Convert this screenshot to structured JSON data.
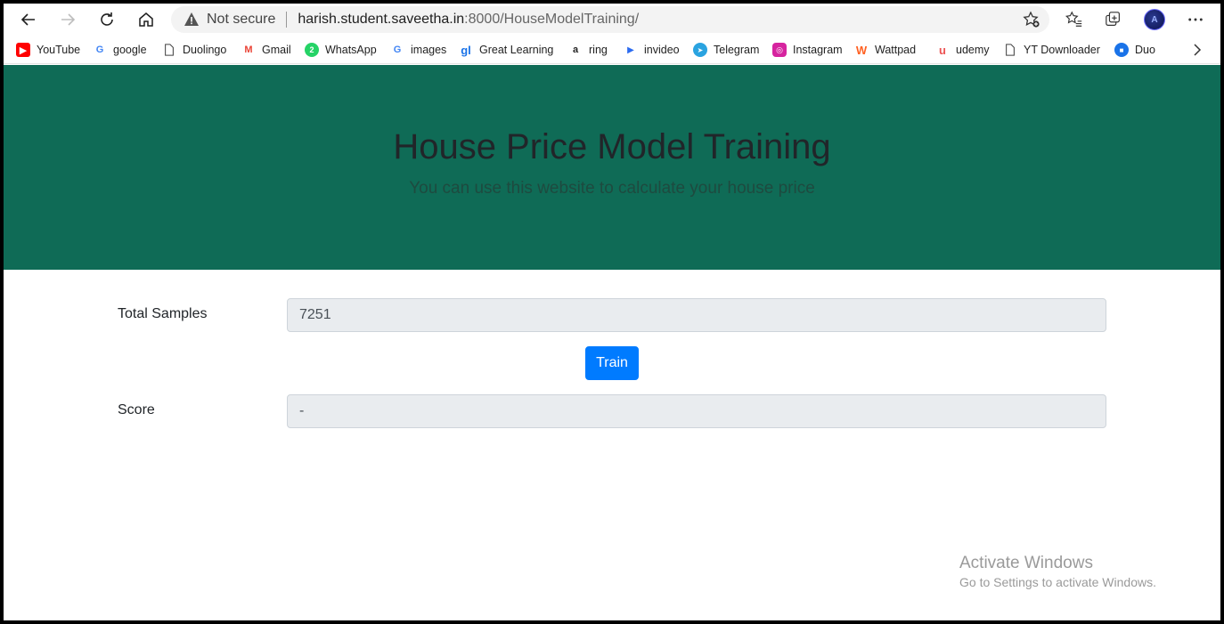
{
  "browser": {
    "address": {
      "warning": "Not secure",
      "host": "harish.student.saveetha.in",
      "rest": ":8000/HouseModelTraining/"
    },
    "avatar_initials": "A",
    "bookmarks": [
      {
        "label": "YouTube",
        "icon": "youtube-icon",
        "color": "#ff0000"
      },
      {
        "label": "google",
        "icon": "google-icon",
        "color": "#4285f4"
      },
      {
        "label": "Duolingo",
        "icon": "page-icon",
        "color": "#555555"
      },
      {
        "label": "Gmail",
        "icon": "gmail-icon",
        "color": "#ea4335"
      },
      {
        "label": "WhatsApp",
        "icon": "whatsapp-icon",
        "color": "#25d366"
      },
      {
        "label": "images",
        "icon": "google-icon",
        "color": "#4285f4"
      },
      {
        "label": "Great Learning",
        "icon": "great-learning-icon",
        "color": "#1a73e8"
      },
      {
        "label": "ring",
        "icon": "amazon-icon",
        "color": "#222222"
      },
      {
        "label": "invideo",
        "icon": "invideo-icon",
        "color": "#2b6bf0"
      },
      {
        "label": "Telegram",
        "icon": "telegram-icon",
        "color": "#2aa3e0"
      },
      {
        "label": "Instagram",
        "icon": "instagram-icon",
        "color": "#d6249f"
      },
      {
        "label": "Wattpad",
        "icon": "wattpad-icon",
        "color": "#ff6122"
      },
      {
        "label": "udemy",
        "icon": "udemy-icon",
        "color": "#ec5252"
      },
      {
        "label": "YT Downloader",
        "icon": "page-icon",
        "color": "#555555"
      },
      {
        "label": "Duo",
        "icon": "duo-icon",
        "color": "#1a73e8"
      }
    ]
  },
  "hero": {
    "title": "House Price Model Training",
    "subtitle": "You can use this website to calculate your house price",
    "background": "#0f6b56"
  },
  "form": {
    "samples_label": "Total Samples",
    "samples_value": "7251",
    "train_label": "Train",
    "score_label": "Score",
    "score_value": "-"
  },
  "watermark": {
    "title": "Activate Windows",
    "subtitle": "Go to Settings to activate Windows."
  }
}
